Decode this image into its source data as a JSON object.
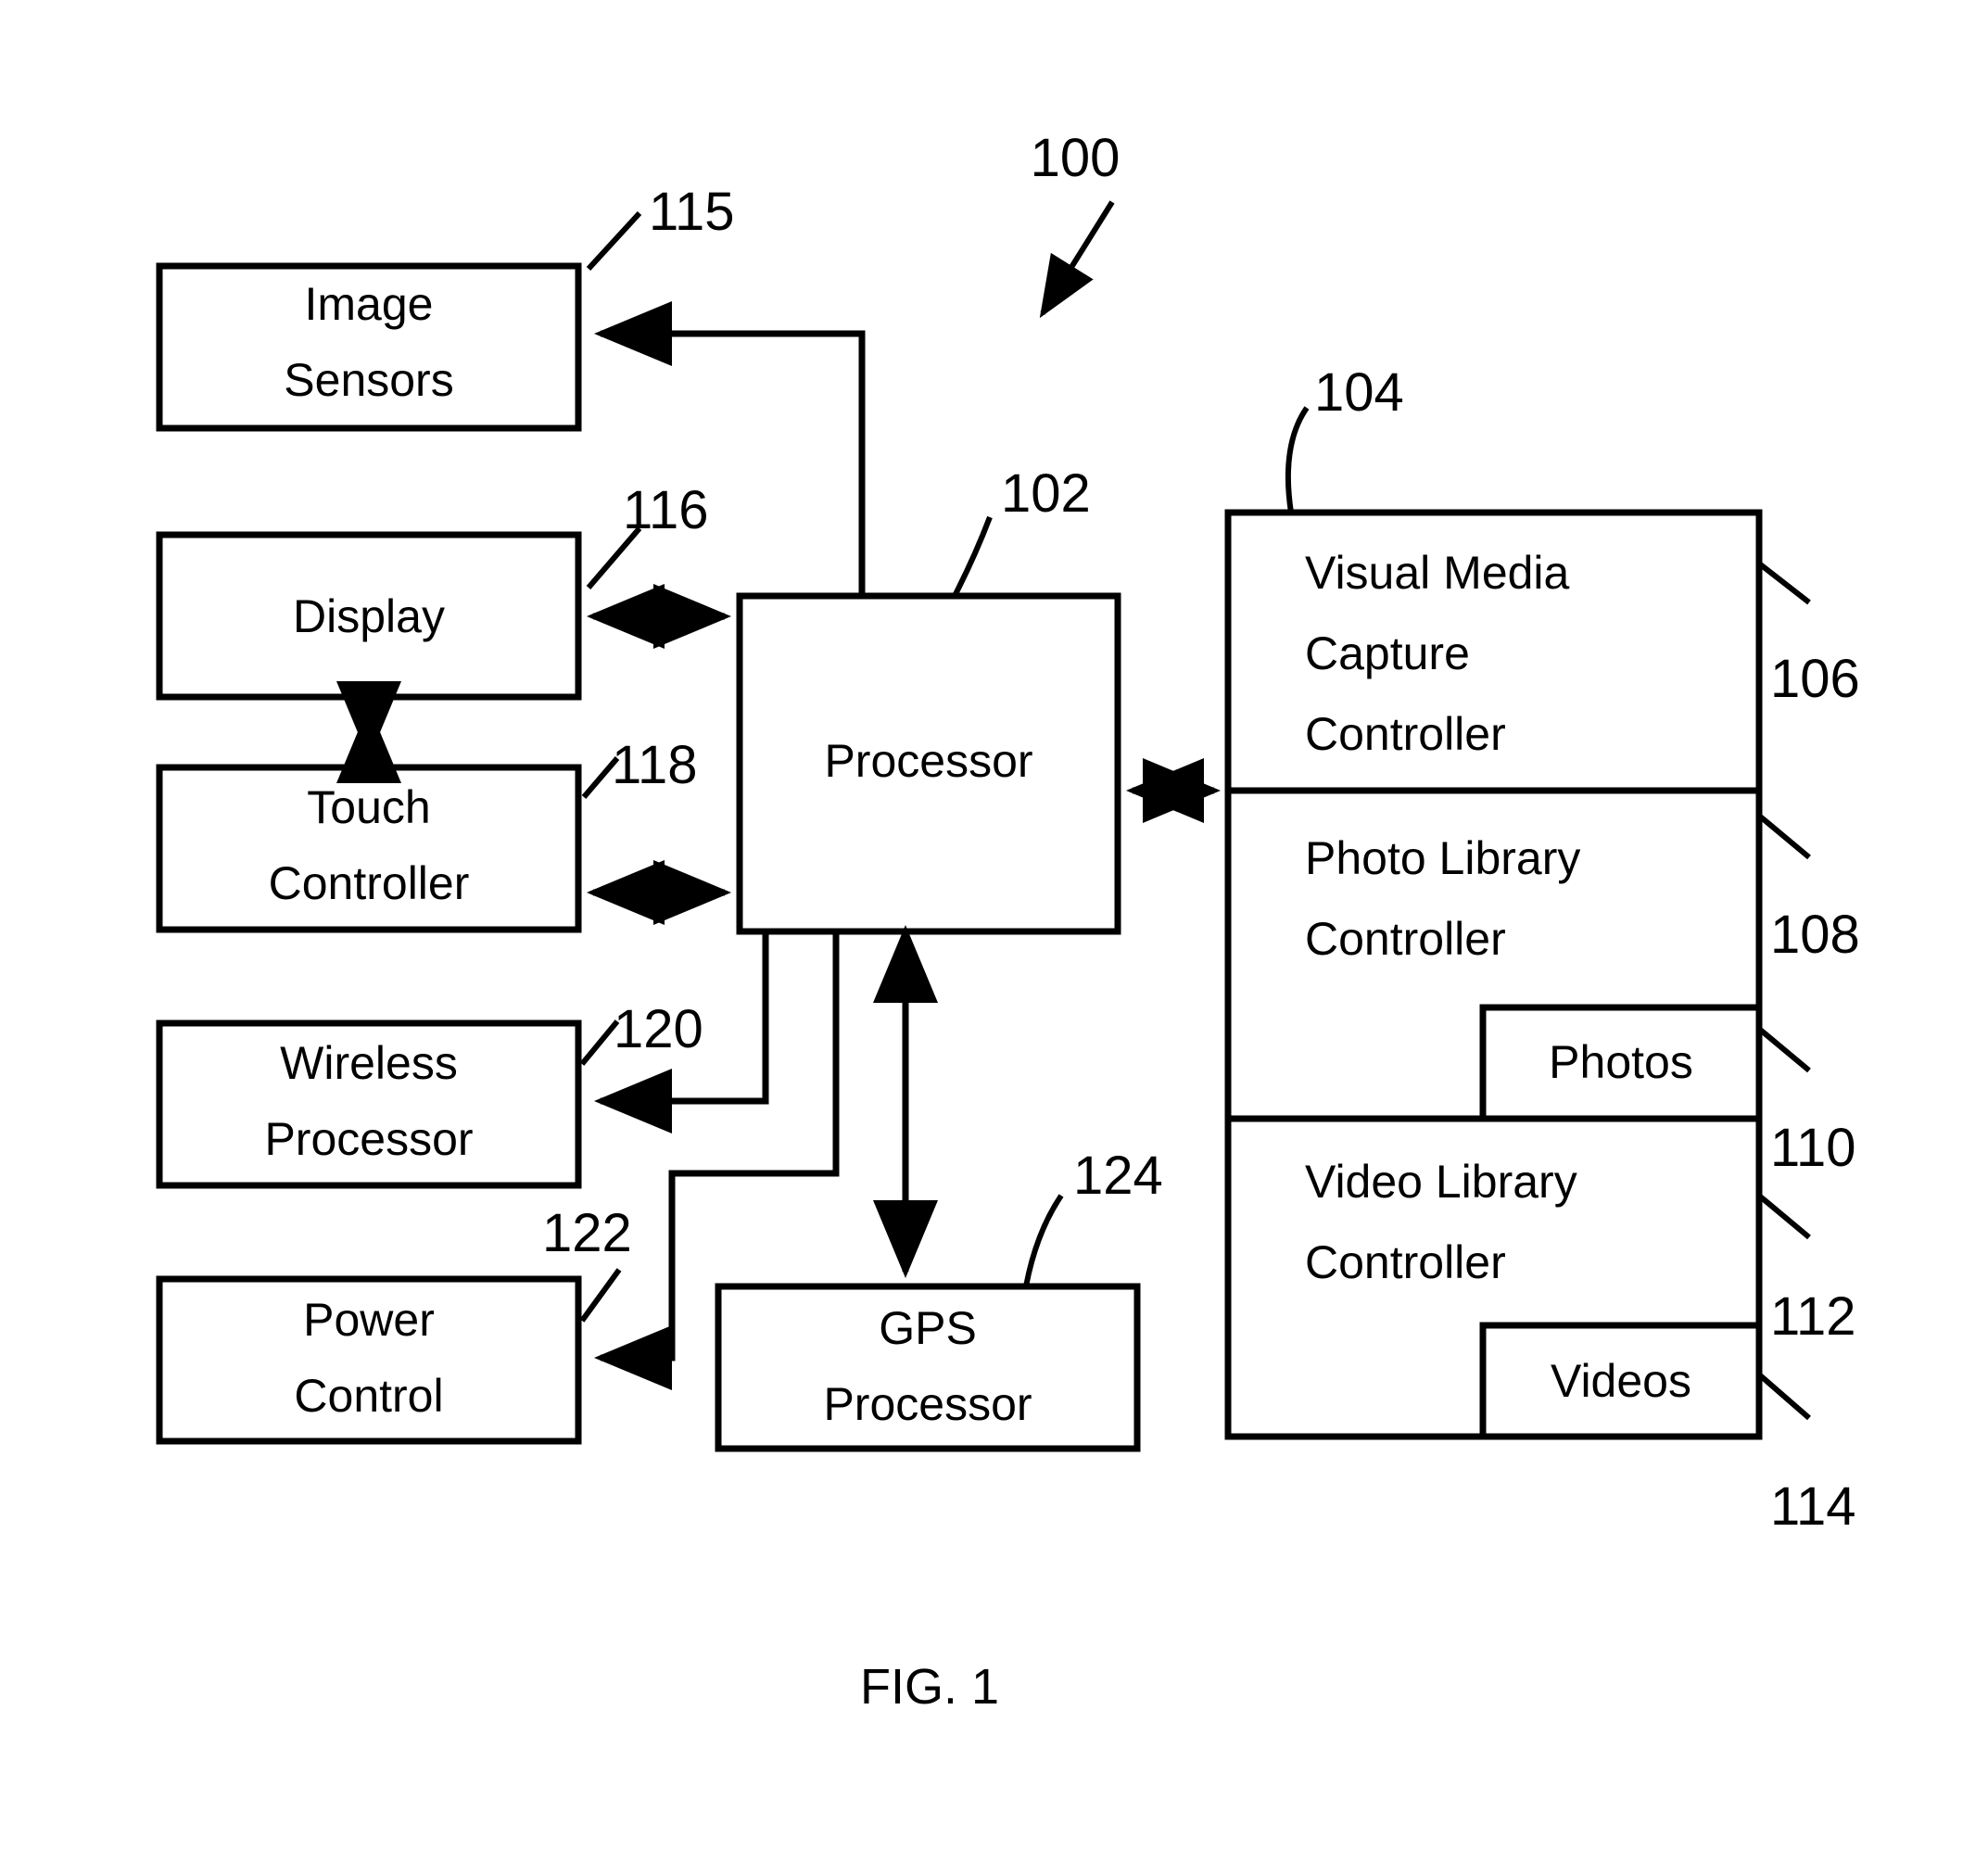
{
  "figure": {
    "caption": "FIG. 1",
    "system_ref": "100"
  },
  "blocks": {
    "image_sensors": {
      "line1": "Image",
      "line2": "Sensors",
      "ref": "115"
    },
    "display": {
      "line1": "Display",
      "ref": "116"
    },
    "touch_controller": {
      "line1": "Touch",
      "line2": "Controller",
      "ref": "118"
    },
    "wireless_processor": {
      "line1": "Wireless",
      "line2": "Processor",
      "ref": "120"
    },
    "power_control": {
      "line1": "Power",
      "line2": "Control",
      "ref": "122"
    },
    "processor": {
      "line1": "Processor",
      "ref": "102"
    },
    "gps_processor": {
      "line1": "GPS",
      "line2": "Processor",
      "ref": "124"
    },
    "memory_container": {
      "ref": "104"
    },
    "visual_media_capture_controller": {
      "line1": "Visual Media",
      "line2": "Capture",
      "line3": "Controller",
      "ref": "106"
    },
    "photo_library_controller": {
      "line1": "Photo Library",
      "line2": "Controller",
      "ref": "108"
    },
    "photos": {
      "line1": "Photos",
      "ref": "110"
    },
    "video_library_controller": {
      "line1": "Video Library",
      "line2": "Controller",
      "ref": "112"
    },
    "videos": {
      "line1": "Videos",
      "ref": "114"
    }
  },
  "colors": {
    "stroke": "#000000",
    "background": "#ffffff"
  }
}
